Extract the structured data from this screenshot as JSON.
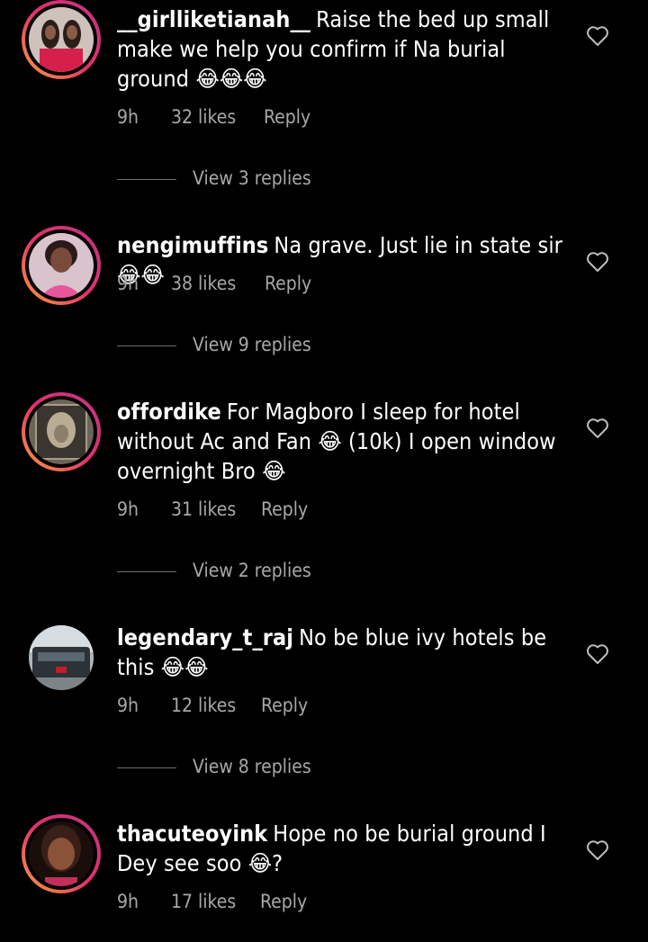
{
  "comments": [
    {
      "username": "__girlliketianah__",
      "text": "Raise the bed up small make we help you confirm if Na burial ground 😂😂😂",
      "time": "9h",
      "likes": "32 likes",
      "reply": "Reply",
      "view_replies": "View 3 replies"
    },
    {
      "username": "nengimuffins",
      "text": "Na grave. Just lie in state sir 😂😂",
      "time": "9h",
      "likes": "38 likes",
      "reply": "Reply",
      "view_replies": "View 9 replies"
    },
    {
      "username": "offordike",
      "text": "For Magboro I sleep for hotel without Ac and Fan 😂 (10k) I open window overnight Bro 😂",
      "time": "9h",
      "likes": "31 likes",
      "reply": "Reply",
      "view_replies": "View 2 replies"
    },
    {
      "username": "legendary_t_raj",
      "text": "No be blue ivy hotels be this 😂😂",
      "time": "9h",
      "likes": "12 likes",
      "reply": "Reply",
      "view_replies": "View 8 replies"
    },
    {
      "username": "thacuteoyink",
      "text": "Hope no be burial ground I Dey see soo 😂?",
      "time": "9h",
      "likes": "17 likes",
      "reply": "Reply"
    }
  ]
}
